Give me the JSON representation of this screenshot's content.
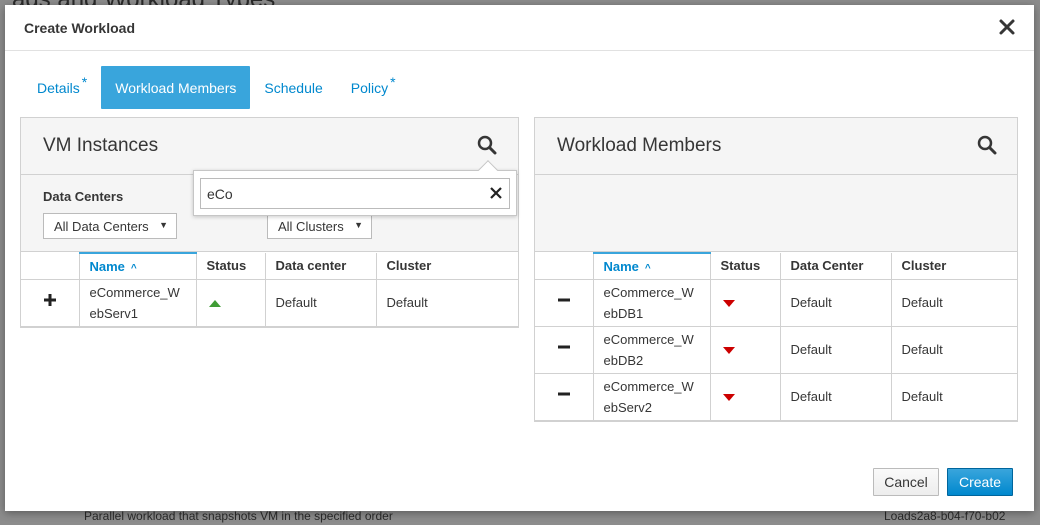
{
  "background": {
    "heading": "ads and Workload Types",
    "footer_left": "Parallel workload that snapshots VM in the specified order",
    "footer_right": "Loads2a8-b04-f70-b02"
  },
  "modal": {
    "title": "Create Workload",
    "close_icon": "close-icon"
  },
  "tabs": [
    {
      "label": "Details",
      "required": "*",
      "active": false
    },
    {
      "label": "Workload Members",
      "required": "",
      "active": true
    },
    {
      "label": "Schedule",
      "required": "",
      "active": false
    },
    {
      "label": "Policy",
      "required": "*",
      "active": false
    }
  ],
  "left_panel": {
    "title": "VM Instances",
    "search_icon": "search-icon",
    "filters": {
      "label": "Data Centers",
      "datacenter_select": "All Data Centers",
      "cluster_select": "All Clusters"
    },
    "search_popover": {
      "value": "eCo"
    },
    "columns": [
      "",
      "Name",
      "Status",
      "Data center",
      "Cluster"
    ],
    "rows": [
      {
        "action": "plus-icon",
        "name_line1": "eCommerce_W",
        "name_line2": "ebServ1",
        "status": "up",
        "datacenter": "Default",
        "cluster": "Default"
      }
    ]
  },
  "right_panel": {
    "title": "Workload Members",
    "search_icon": "search-icon",
    "columns": [
      "",
      "Name",
      "Status",
      "Data Center",
      "Cluster"
    ],
    "rows": [
      {
        "action": "minus-icon",
        "name_line1": "eCommerce_W",
        "name_line2": "ebDB1",
        "status": "down",
        "datacenter": "Default",
        "cluster": "Default"
      },
      {
        "action": "minus-icon",
        "name_line1": "eCommerce_W",
        "name_line2": "ebDB2",
        "status": "down",
        "datacenter": "Default",
        "cluster": "Default"
      },
      {
        "action": "minus-icon",
        "name_line1": "eCommerce_W",
        "name_line2": "ebServ2",
        "status": "down",
        "datacenter": "Default",
        "cluster": "Default"
      }
    ]
  },
  "footer": {
    "cancel_label": "Cancel",
    "create_label": "Create"
  },
  "colors": {
    "accent": "#0088ce",
    "active_tab": "#39a5dc",
    "status_up": "#3f9c35",
    "status_down": "#cc0000"
  }
}
